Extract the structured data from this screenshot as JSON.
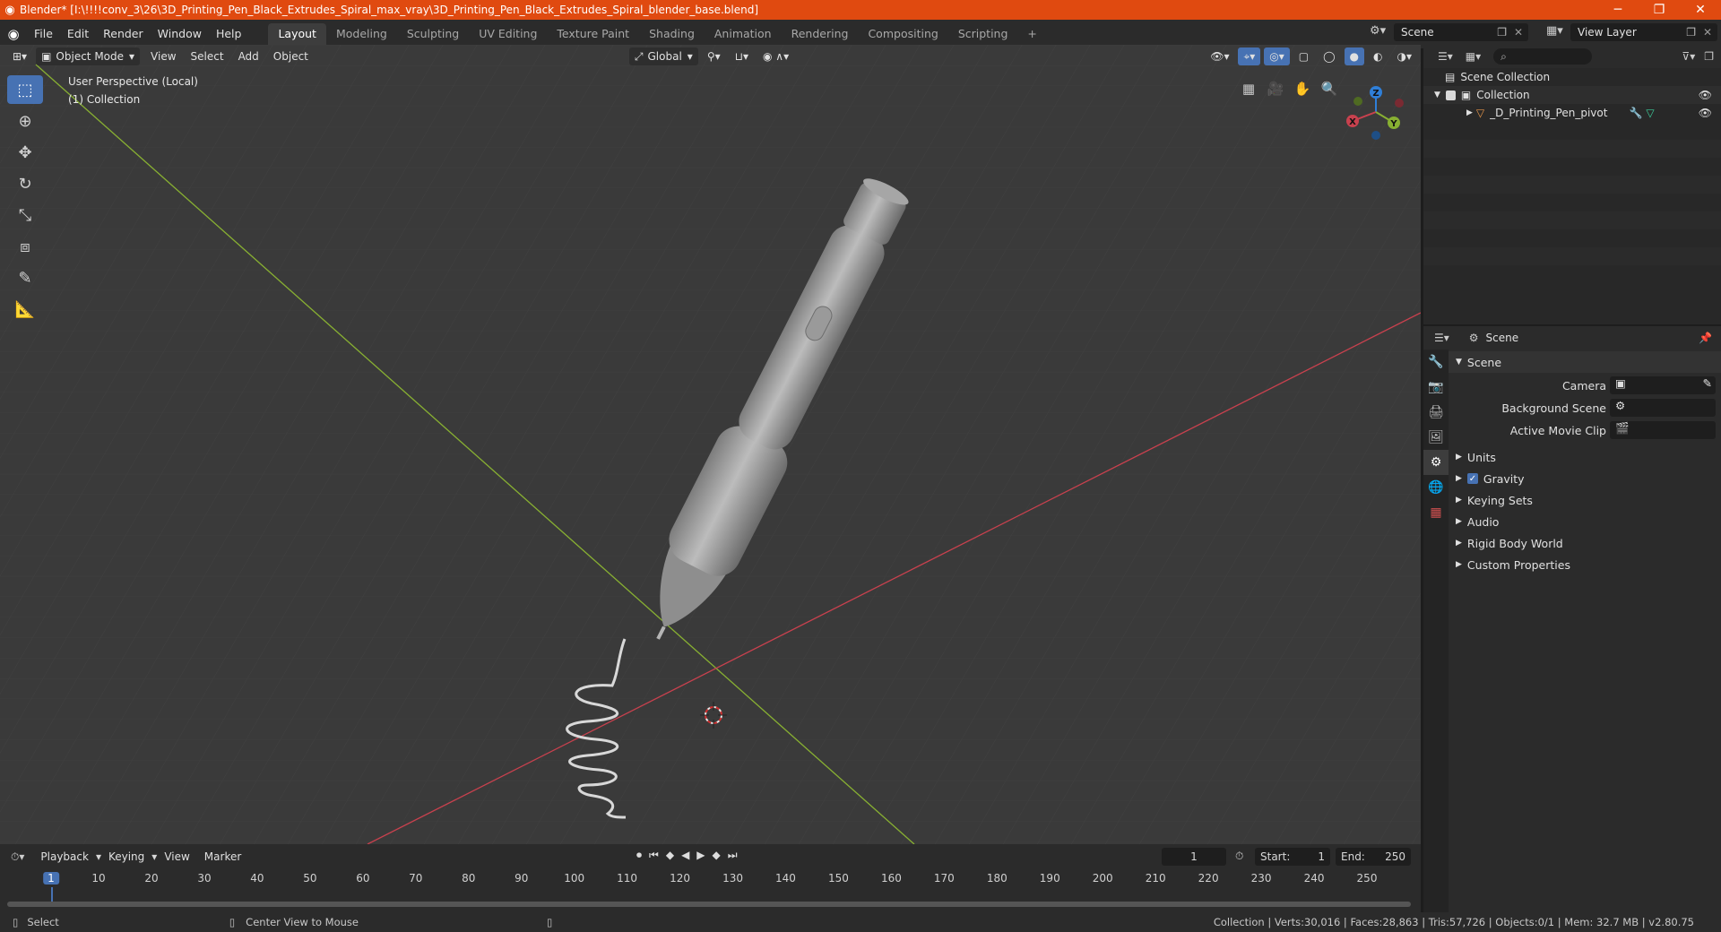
{
  "window": {
    "title": "Blender* [I:\\!!!!conv_3\\26\\3D_Printing_Pen_Black_Extrudes_Spiral_max_vray\\3D_Printing_Pen_Black_Extrudes_Spiral_blender_base.blend]",
    "controls": [
      "─",
      "❐",
      "✕"
    ]
  },
  "menu": [
    "File",
    "Edit",
    "Render",
    "Window",
    "Help"
  ],
  "workspaces": [
    "Layout",
    "Modeling",
    "Sculpting",
    "UV Editing",
    "Texture Paint",
    "Shading",
    "Animation",
    "Rendering",
    "Compositing",
    "Scripting"
  ],
  "active_workspace": "Layout",
  "scene_selector": "Scene",
  "view_layer_selector": "View Layer",
  "viewport": {
    "mode": "Object Mode",
    "menus": [
      "View",
      "Select",
      "Add",
      "Object"
    ],
    "orientation": "Global",
    "perspective_label": "User Perspective (Local)",
    "collection_label": "(1) Collection",
    "gizmo_axes": {
      "x": "X",
      "y": "Y",
      "z": "Z"
    }
  },
  "outliner": {
    "root": "Scene Collection",
    "collection": "Collection",
    "object": "_D_Printing_Pen_pivot"
  },
  "properties": {
    "header": "Scene",
    "panel_title": "Scene",
    "camera_label": "Camera",
    "background_scene_label": "Background Scene",
    "active_movie_clip_label": "Active Movie Clip",
    "sections": [
      "Units",
      "Gravity",
      "Keying Sets",
      "Audio",
      "Rigid Body World",
      "Custom Properties"
    ],
    "gravity_checked": true
  },
  "timeline": {
    "menus": [
      "Playback",
      "Keying",
      "View",
      "Marker"
    ],
    "current_frame": "1",
    "start_label": "Start:",
    "start": "1",
    "end_label": "End:",
    "end": "250",
    "ticks": [
      "1",
      "10",
      "20",
      "30",
      "40",
      "50",
      "60",
      "70",
      "80",
      "90",
      "100",
      "110",
      "120",
      "130",
      "140",
      "150",
      "160",
      "170",
      "180",
      "190",
      "200",
      "210",
      "220",
      "230",
      "240",
      "250"
    ]
  },
  "status": {
    "select": "Select",
    "center_view": "Center View to Mouse",
    "stats": "Collection | Verts:30,016 | Faces:28,863 | Tris:57,726 | Objects:0/1 | Mem: 32.7 MB | v2.80.75"
  },
  "colors": {
    "title_bar": "#e04a10",
    "accent": "#4772b3",
    "x_axis": "#c8414e",
    "y_axis": "#88b032",
    "z_axis": "#2f7fd8"
  }
}
